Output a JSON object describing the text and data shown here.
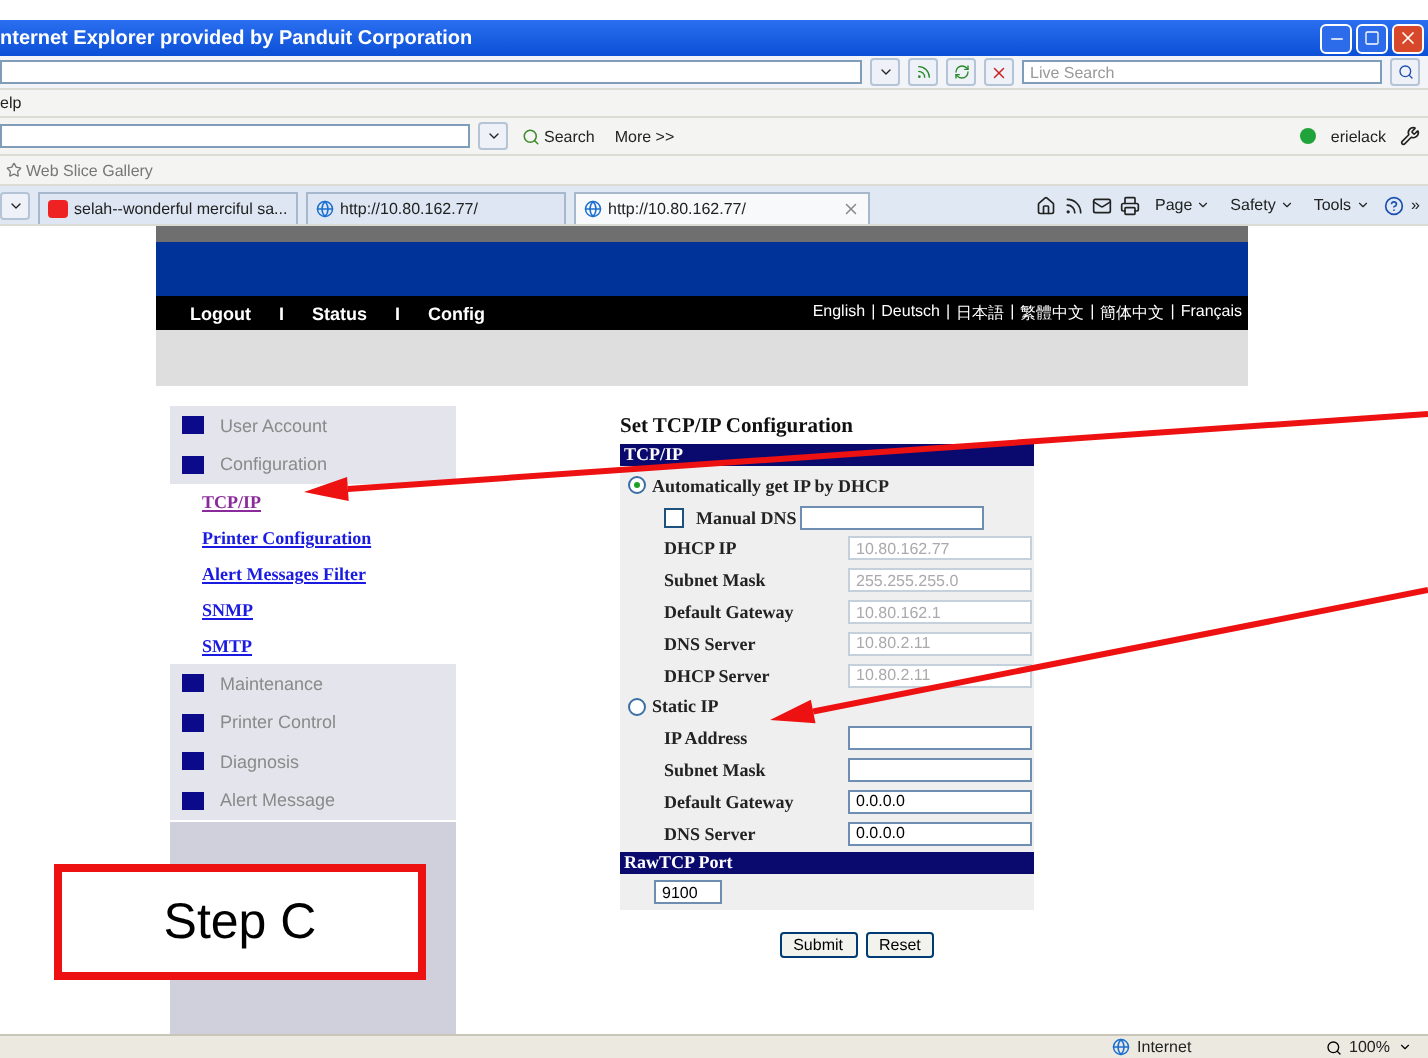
{
  "browser": {
    "title": "nternet Explorer provided by Panduit Corporation",
    "search_placeholder": "Live Search",
    "menu": "elp",
    "toolbar": {
      "search": "Search",
      "more": "More >>",
      "user": "erielack"
    },
    "favorites": "Web Slice Gallery",
    "tabs": [
      {
        "label": "selah--wonderful merciful sa...",
        "selected": false,
        "kind": "video"
      },
      {
        "label": "http://10.80.162.77/",
        "selected": false,
        "kind": "web"
      },
      {
        "label": "http://10.80.162.77/",
        "selected": true,
        "kind": "web"
      }
    ],
    "commands": [
      "Page",
      "Safety",
      "Tools"
    ],
    "overflow": "»"
  },
  "header": {
    "nav": [
      "Logout",
      "Status",
      "Config"
    ],
    "nav_separators": [
      "I",
      "I"
    ],
    "languages": [
      "English",
      "Deutsch",
      "日本語",
      "繁體中文",
      "簡体中文",
      "Français"
    ],
    "language_separators": [
      "|",
      "|",
      "|",
      "|",
      "|"
    ]
  },
  "sidebar": [
    {
      "label": "User Account",
      "kind": "category"
    },
    {
      "label": "Configuration",
      "kind": "category"
    },
    {
      "label": "TCP/IP",
      "kind": "link",
      "selected": true
    },
    {
      "label": "Printer Configuration",
      "kind": "link",
      "selected": false
    },
    {
      "label": "Alert Messages Filter",
      "kind": "link",
      "selected": false
    },
    {
      "label": "SNMP",
      "kind": "link",
      "selected": false
    },
    {
      "label": "SMTP",
      "kind": "link",
      "selected": false
    },
    {
      "label": "Maintenance",
      "kind": "category"
    },
    {
      "label": "Printer Control",
      "kind": "category"
    },
    {
      "label": "Diagnosis",
      "kind": "category"
    },
    {
      "label": "Alert Message",
      "kind": "category"
    }
  ],
  "form": {
    "title": "Set TCP/IP Configuration",
    "sections": [
      {
        "header": "TCP/IP",
        "rows": [
          {
            "kind": "radio",
            "label": "Automatically get IP by DHCP",
            "selected": true
          },
          {
            "kind": "checkbox",
            "label": "Manual DNS",
            "checked": false,
            "value": "",
            "disabled": false
          },
          {
            "kind": "field",
            "label": "DHCP IP",
            "value": "10.80.162.77",
            "disabled": true
          },
          {
            "kind": "field",
            "label": "Subnet Mask",
            "value": "255.255.255.0",
            "disabled": true
          },
          {
            "kind": "field",
            "label": "Default Gateway",
            "value": "10.80.162.1",
            "disabled": true
          },
          {
            "kind": "field",
            "label": "DNS Server",
            "value": "10.80.2.11",
            "disabled": true
          },
          {
            "kind": "field",
            "label": "DHCP Server",
            "value": "10.80.2.11",
            "disabled": true
          },
          {
            "kind": "radio",
            "label": "Static IP",
            "selected": false
          },
          {
            "kind": "field",
            "label": "IP Address",
            "value": "",
            "disabled": false
          },
          {
            "kind": "field",
            "label": "Subnet Mask",
            "value": "",
            "disabled": false
          },
          {
            "kind": "field",
            "label": "Default Gateway",
            "value": "0.0.0.0",
            "disabled": false
          },
          {
            "kind": "field",
            "label": "DNS Server",
            "value": "0.0.0.0",
            "disabled": false
          }
        ]
      },
      {
        "header": "RawTCP Port",
        "rows": [
          {
            "kind": "port",
            "value": "9100",
            "disabled": false
          }
        ]
      }
    ],
    "buttons": [
      "Submit",
      "Reset"
    ]
  },
  "status_bar": {
    "zone": "Internet",
    "zoom": "100%"
  },
  "annotation": {
    "label": "Step C"
  }
}
